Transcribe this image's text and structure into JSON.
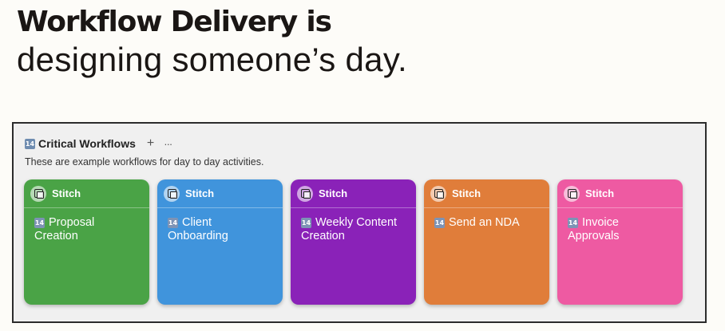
{
  "headline": {
    "line1": "Workflow Delivery is",
    "line2": "designing someone’s day."
  },
  "board": {
    "calendar_icon_text": "14",
    "title": "Critical Workflows",
    "add_symbol": "+",
    "more_symbol": "···",
    "description": "These are example workflows for day to day activities."
  },
  "cards": [
    {
      "brand": "Stitch",
      "title": "Proposal Creation",
      "color": "#4aa346"
    },
    {
      "brand": "Stitch",
      "title": "Client Onboarding",
      "color": "#4094dc"
    },
    {
      "brand": "Stitch",
      "title": "Weekly Content Creation",
      "color": "#8a22b8"
    },
    {
      "brand": "Stitch",
      "title": "Send an NDA",
      "color": "#e07d3a"
    },
    {
      "brand": "Stitch",
      "title": "Invoice Approvals",
      "color": "#ee5aa2"
    }
  ]
}
